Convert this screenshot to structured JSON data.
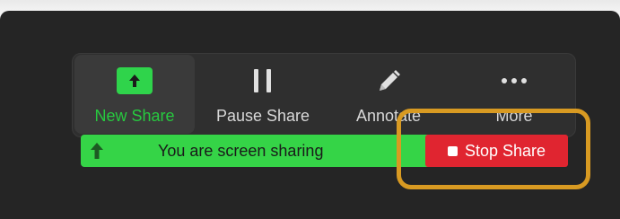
{
  "toolbar": {
    "items": [
      {
        "label": "New Share",
        "icon": "up-arrow-icon"
      },
      {
        "label": "Pause Share",
        "icon": "pause-icon"
      },
      {
        "label": "Annotate",
        "icon": "pencil-icon"
      },
      {
        "label": "More",
        "icon": "more-dots-icon"
      }
    ]
  },
  "banner": {
    "message": "You are screen sharing",
    "stop_label": "Stop Share"
  },
  "colors": {
    "accent_green": "#35d447",
    "stop_red": "#e02530",
    "highlight": "#d89a22",
    "toolbar_bg": "#2f2f2f"
  }
}
